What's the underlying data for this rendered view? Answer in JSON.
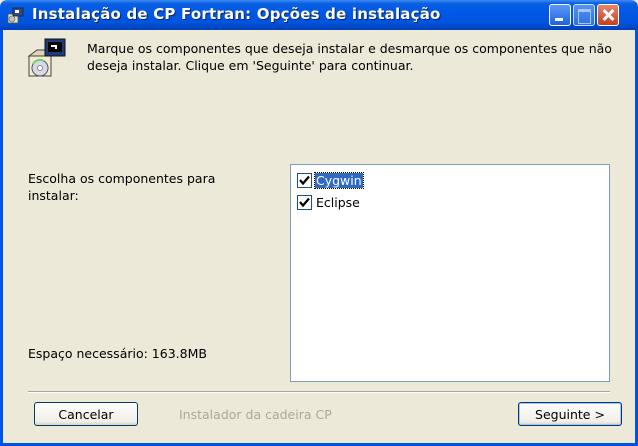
{
  "window": {
    "title": "Instalação de CP Fortran: Opções de instalação"
  },
  "header": {
    "instructions": "Marque os componentes que deseja instalar e desmarque os componentes que não deseja instalar. Clique em 'Seguinte' para continuar."
  },
  "components": {
    "choose_label": "Escolha os componentes para instalar:",
    "items": [
      {
        "label": "Cygwin",
        "checked": true,
        "selected": true
      },
      {
        "label": "Eclipse",
        "checked": true,
        "selected": false
      }
    ]
  },
  "space": {
    "label": "Espaço necessário: 163.8MB"
  },
  "footer": {
    "cancel_label": "Cancelar",
    "brand": "Instalador da cadeira CP",
    "next_label": "Seguinte >"
  },
  "colors": {
    "titlebar": "#0054e3",
    "face": "#ece9d8",
    "selection": "#316ac5"
  },
  "icons": {
    "title": "installer-icon",
    "header": "installer-box-icon",
    "check": "checkmark-icon"
  }
}
